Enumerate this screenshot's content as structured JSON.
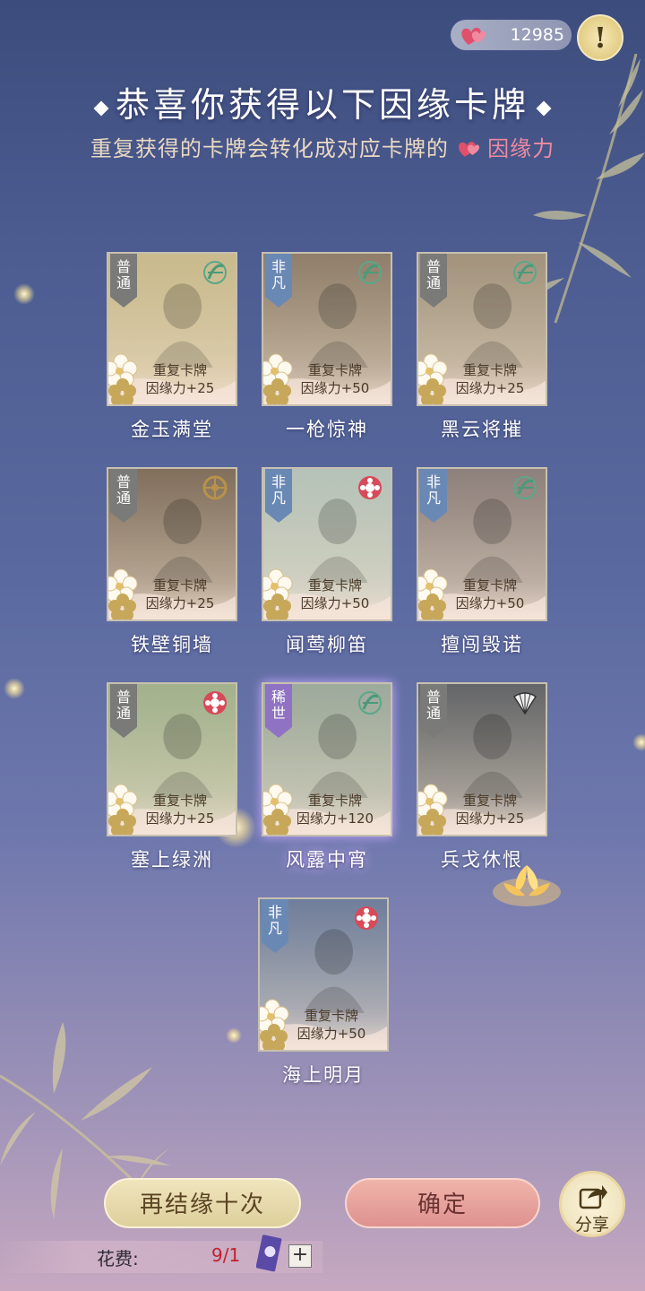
{
  "header": {
    "currency_value": "12985",
    "notice_symbol": "!"
  },
  "title": "恭喜你获得以下因缘卡牌",
  "subtitle": {
    "text": "重复获得的卡牌会转化成对应卡牌的",
    "highlight": "因缘力"
  },
  "cards": [
    {
      "name": "金玉满堂",
      "rarity": "普通",
      "tier": "common",
      "dup_line1": "重复卡牌",
      "dup_line2": "因缘力+25",
      "art": "#c9b98a",
      "emblem": "bow-icon"
    },
    {
      "name": "一枪惊神",
      "rarity": "非凡",
      "tier": "rare",
      "dup_line1": "重复卡牌",
      "dup_line2": "因缘力+50",
      "art": "#8c7a66",
      "emblem": "bow-icon"
    },
    {
      "name": "黑云将摧",
      "rarity": "普通",
      "tier": "common",
      "dup_line1": "重复卡牌",
      "dup_line2": "因缘力+25",
      "art": "#a0907a",
      "emblem": "bow-icon"
    },
    {
      "name": "铁壁铜墙",
      "rarity": "普通",
      "tier": "common",
      "dup_line1": "重复卡牌",
      "dup_line2": "因缘力+25",
      "art": "#7d6a58",
      "emblem": "wheel-icon"
    },
    {
      "name": "闻莺柳笛",
      "rarity": "非凡",
      "tier": "rare",
      "dup_line1": "重复卡牌",
      "dup_line2": "因缘力+50",
      "art": "#b4c2b8",
      "emblem": "flower-emblem-icon"
    },
    {
      "name": "擅闯毁诺",
      "rarity": "非凡",
      "tier": "rare",
      "dup_line1": "重复卡牌",
      "dup_line2": "因缘力+50",
      "art": "#8a7c78",
      "emblem": "bow-icon"
    },
    {
      "name": "塞上绿洲",
      "rarity": "普通",
      "tier": "common",
      "dup_line1": "重复卡牌",
      "dup_line2": "因缘力+25",
      "art": "#9fb08a",
      "emblem": "flower-emblem-icon"
    },
    {
      "name": "风露中宵",
      "rarity": "稀世",
      "tier": "epic",
      "dup_line1": "重复卡牌",
      "dup_line2": "因缘力+120",
      "art": "#9aa89a",
      "emblem": "bow-icon"
    },
    {
      "name": "兵戈休恨",
      "rarity": "普通",
      "tier": "common",
      "dup_line1": "重复卡牌",
      "dup_line2": "因缘力+25",
      "art": "#5e6064",
      "emblem": "fan-icon"
    },
    {
      "name": "海上明月",
      "rarity": "非凡",
      "tier": "rare",
      "dup_line1": "重复卡牌",
      "dup_line2": "因缘力+50",
      "art": "#6a7a9a",
      "emblem": "flower-emblem-icon"
    }
  ],
  "buttons": {
    "again_label": "再结缘十次",
    "confirm_label": "确定",
    "share_label": "分享"
  },
  "cost": {
    "label": "花费:",
    "value": "9/1",
    "plus": "+"
  },
  "colors": {
    "heart": "#e0506a",
    "rare_ribbon": "#6a88b4",
    "common_ribbon": "#7a7a78",
    "epic_ribbon": "#8f72c4"
  }
}
